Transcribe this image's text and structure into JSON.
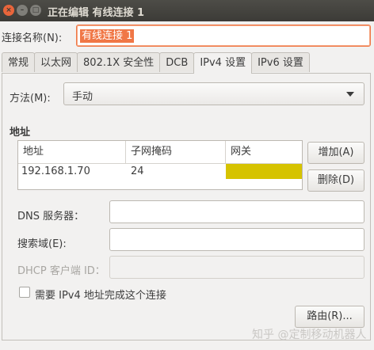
{
  "window": {
    "title": "正在编辑 有线连接 1",
    "close_glyph": "×",
    "minimize_glyph": "–",
    "maximize_glyph": "□"
  },
  "connection": {
    "label": "连接名称(N):",
    "value": "有线连接 1"
  },
  "tabs": [
    {
      "label": "常规"
    },
    {
      "label": "以太网"
    },
    {
      "label": "802.1X 安全性"
    },
    {
      "label": "DCB"
    },
    {
      "label": "IPv4 设置"
    },
    {
      "label": "IPv6 设置"
    }
  ],
  "active_tab": "IPv4 设置",
  "ipv4": {
    "method_label": "方法(M):",
    "method_value": "手动",
    "address_heading": "地址",
    "table": {
      "headers": [
        "地址",
        "子网掩码",
        "网关"
      ],
      "rows": [
        [
          "192.168.1.70",
          "24",
          ""
        ]
      ]
    },
    "add_button": "增加(A)",
    "delete_button": "删除(D)",
    "dns_label": "DNS 服务器：",
    "search_label": "搜索域(E):",
    "dhcp_label": "DHCP 客户端 ID：",
    "require_label": "需要 IPv4 地址完成这个连接",
    "route_button": "路由(R)..."
  },
  "colors": {
    "accent": "#f07746",
    "gateway_cell": "#d6c300",
    "titlebar": "#3c3b37"
  },
  "watermark": "知乎 @定制移动机器人"
}
